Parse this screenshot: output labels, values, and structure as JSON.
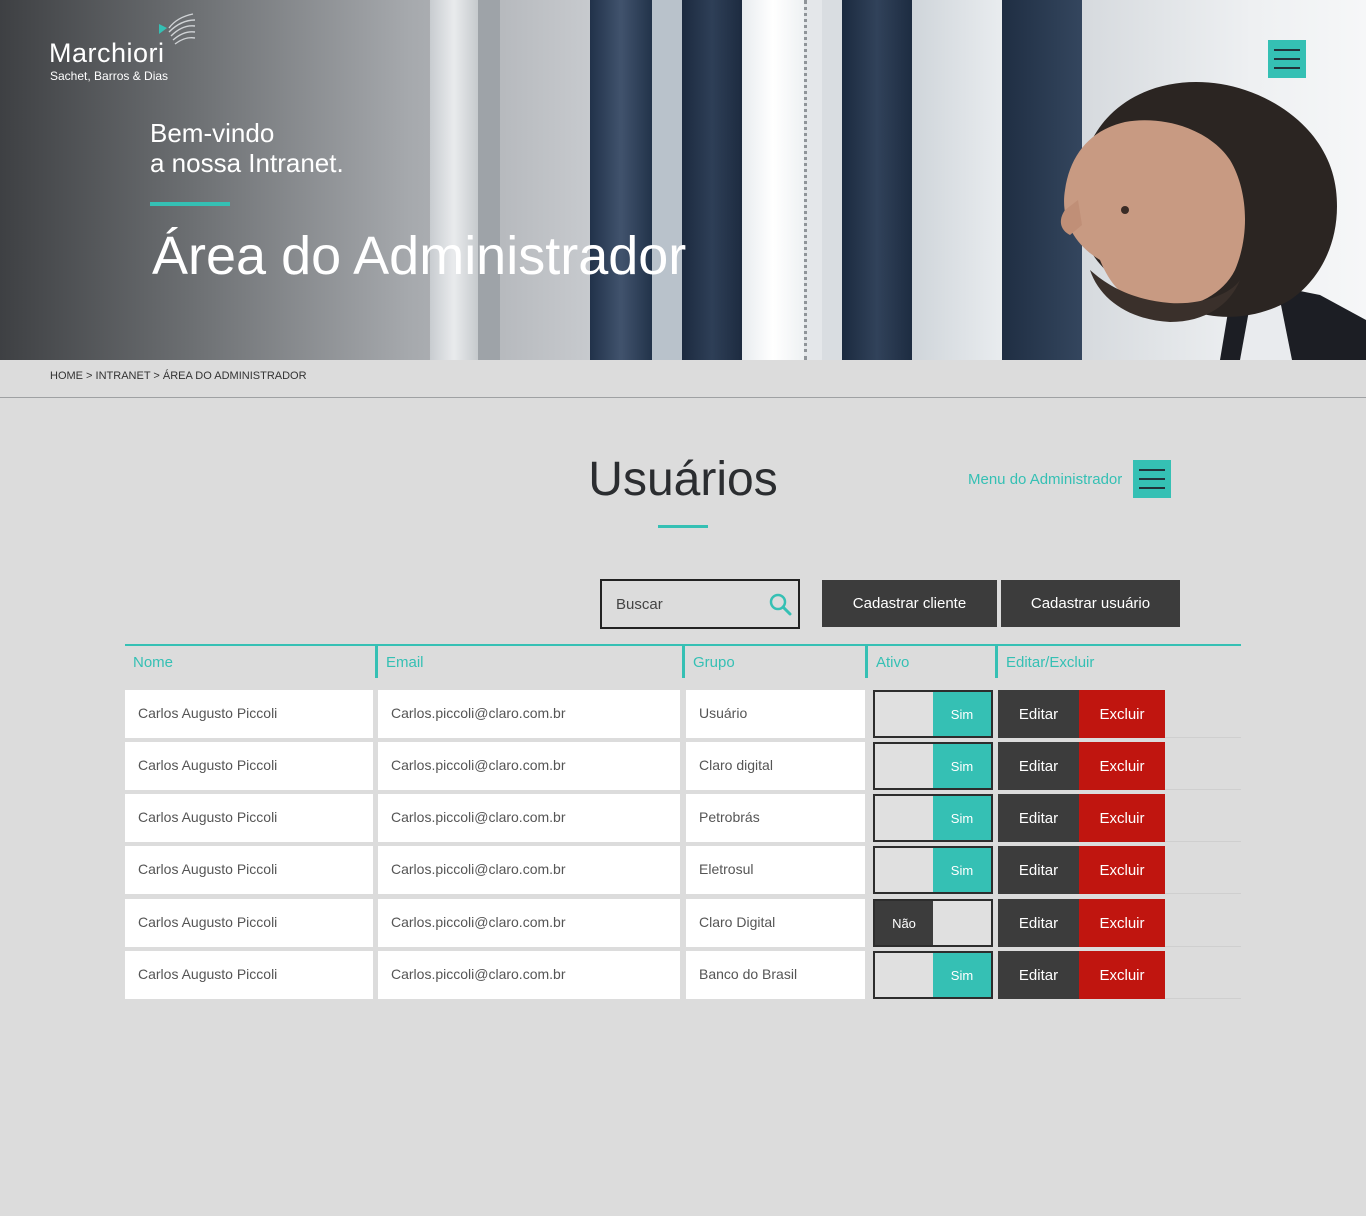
{
  "brand": {
    "name": "Marchiori",
    "tagline": "Sachet, Barros & Dias",
    "accent": "#35c0b4"
  },
  "hero": {
    "welcome_line1": "Bem-vindo",
    "welcome_line2": "a nossa Intranet.",
    "title": "Área do Administrador"
  },
  "breadcrumb": {
    "home": "HOME",
    "sep1": " > ",
    "intranet": "INTRANET",
    "sep2": " > ",
    "current": "ÁREA DO ADMINISTRADOR"
  },
  "section": {
    "title": "Usuários",
    "admin_menu_label": "Menu do Administrador"
  },
  "toolbar": {
    "search_placeholder": "Buscar",
    "register_client": "Cadastrar cliente",
    "register_user": "Cadastrar usuário"
  },
  "table": {
    "headers": {
      "name": "Nome",
      "email": "Email",
      "group": "Grupo",
      "active": "Ativo",
      "actions": "Editar/Excluir"
    },
    "edit_label": "Editar",
    "delete_label": "Excluir",
    "rows": [
      {
        "name": "Carlos Augusto Piccoli",
        "email": "Carlos.piccoli@claro.com.br",
        "group": "Usuário",
        "active": "Sim"
      },
      {
        "name": "Carlos Augusto Piccoli",
        "email": "Carlos.piccoli@claro.com.br",
        "group": "Claro digital",
        "active": "Sim"
      },
      {
        "name": "Carlos Augusto Piccoli",
        "email": "Carlos.piccoli@claro.com.br",
        "group": "Petrobrás",
        "active": "Sim"
      },
      {
        "name": "Carlos Augusto Piccoli",
        "email": "Carlos.piccoli@claro.com.br",
        "group": "Eletrosul",
        "active": "Sim"
      },
      {
        "name": "Carlos Augusto Piccoli",
        "email": "Carlos.piccoli@claro.com.br",
        "group": "Claro Digital",
        "active": "Não"
      },
      {
        "name": "Carlos Augusto Piccoli",
        "email": "Carlos.piccoli@claro.com.br",
        "group": "Banco do Brasil",
        "active": "Sim"
      }
    ]
  }
}
